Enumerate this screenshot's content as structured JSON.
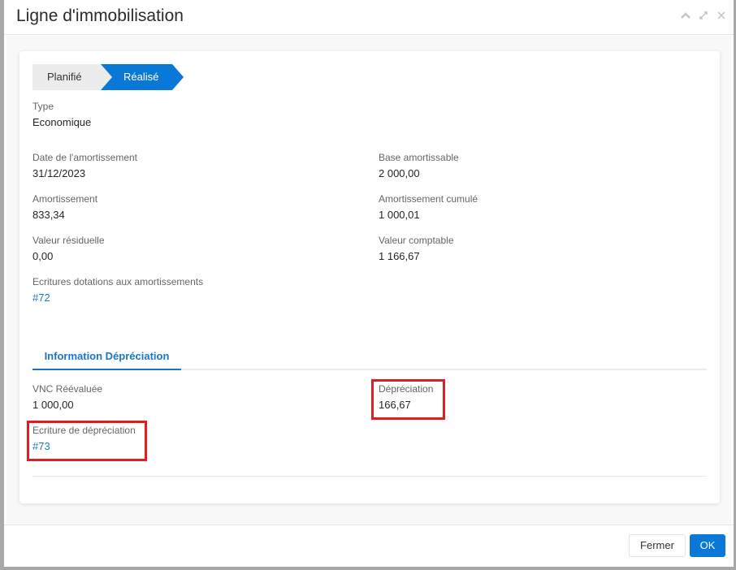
{
  "dialog": {
    "title": "Ligne d'immobilisation",
    "header_icons": [
      "chevron-up-icon",
      "expand-icon",
      "close-icon"
    ]
  },
  "steps": [
    {
      "label": "Planifié",
      "active": false
    },
    {
      "label": "Réalisé",
      "active": true
    }
  ],
  "fields": {
    "type": {
      "label": "Type",
      "value": "Economique"
    },
    "date": {
      "label": "Date de l'amortissement",
      "value": "31/12/2023"
    },
    "base": {
      "label": "Base amortissable",
      "value": "2 000,00"
    },
    "amortissement": {
      "label": "Amortissement",
      "value": "833,34"
    },
    "cumule": {
      "label": "Amortissement cumulé",
      "value": "1 000,01"
    },
    "residuelle": {
      "label": "Valeur résiduelle",
      "value": "0,00"
    },
    "comptable": {
      "label": "Valeur comptable",
      "value": "1 166,67"
    },
    "ecritures": {
      "label": "Ecritures dotations aux amortissements",
      "value": "#72"
    }
  },
  "tab": {
    "label": "Information Dépréciation"
  },
  "depreciation": {
    "vnc": {
      "label": "VNC Réévaluée",
      "value": "1 000,00"
    },
    "depreciation": {
      "label": "Dépréciation",
      "value": "166,67"
    },
    "ecriture": {
      "label": "Ecriture de dépréciation",
      "value": "#73"
    }
  },
  "footer": {
    "close_label": "Fermer",
    "ok_label": "OK"
  },
  "colors": {
    "accent": "#0a78d7",
    "link": "#1a76c9",
    "highlight": "#e31c23"
  }
}
